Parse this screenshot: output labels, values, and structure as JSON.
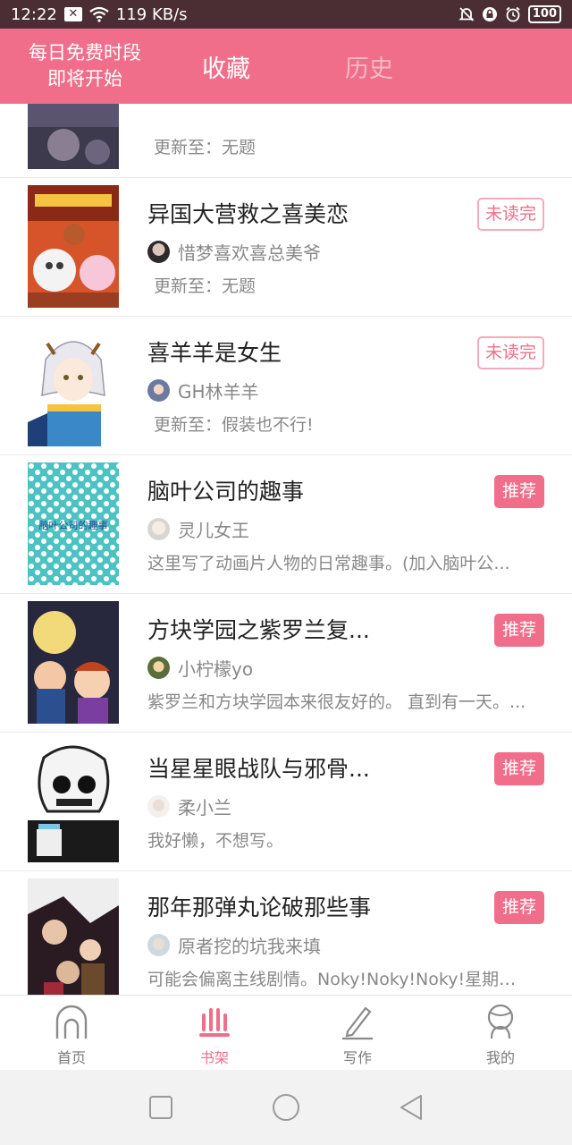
{
  "status": {
    "time": "12:22",
    "speed": "119 KB/s",
    "battery": "100"
  },
  "header": {
    "promo_line1": "每日免费时段",
    "promo_line2": "即将开始",
    "tab_active": "收藏",
    "tab_inactive": "历史"
  },
  "books": [
    {
      "title": "",
      "author": "",
      "desc": "更新至：无题",
      "badge": ""
    },
    {
      "title": "异国大营救之喜美恋",
      "author": "惜梦喜欢喜总美爷",
      "desc": "更新至：无题",
      "badge": "未读完"
    },
    {
      "title": "喜羊羊是女生",
      "author": "GH林羊羊",
      "desc": "更新至：假装也不行!",
      "badge": "未读完"
    },
    {
      "title": "脑叶公司的趣事",
      "author": "灵儿女王",
      "desc": "这里写了动画片人物的日常趣事。(加入脑叶公...",
      "badge": "推荐",
      "cover_text": "脑叶公司的趣事"
    },
    {
      "title": "方块学园之紫罗兰复...",
      "author": "小柠檬yo",
      "desc": "紫罗兰和方块学园本来很友好的。 直到有一天。...",
      "badge": "推荐"
    },
    {
      "title": "当星星眼战队与邪骨...",
      "author": "柔小兰",
      "desc": "我好懒，不想写。",
      "badge": "推荐"
    },
    {
      "title": "那年那弹丸论破那些事",
      "author": "原者挖的坑我来填",
      "desc": "可能会偏离主线剧情。Noky!Noky!Noky!星期五...",
      "badge": "推荐"
    },
    {
      "title": "",
      "author": "",
      "desc": "",
      "badge": ""
    }
  ],
  "tabs": {
    "home": "首页",
    "shelf": "书架",
    "write": "写作",
    "mine": "我的"
  },
  "colors": {
    "accent": "#f06e8a",
    "status_bg": "#4a2e33"
  },
  "icons": [
    "wifi-icon",
    "mute-icon",
    "lock-icon",
    "alarm-icon",
    "home-icon",
    "bookshelf-icon",
    "pen-icon",
    "person-icon",
    "square-icon",
    "circle-icon",
    "back-triangle-icon"
  ]
}
